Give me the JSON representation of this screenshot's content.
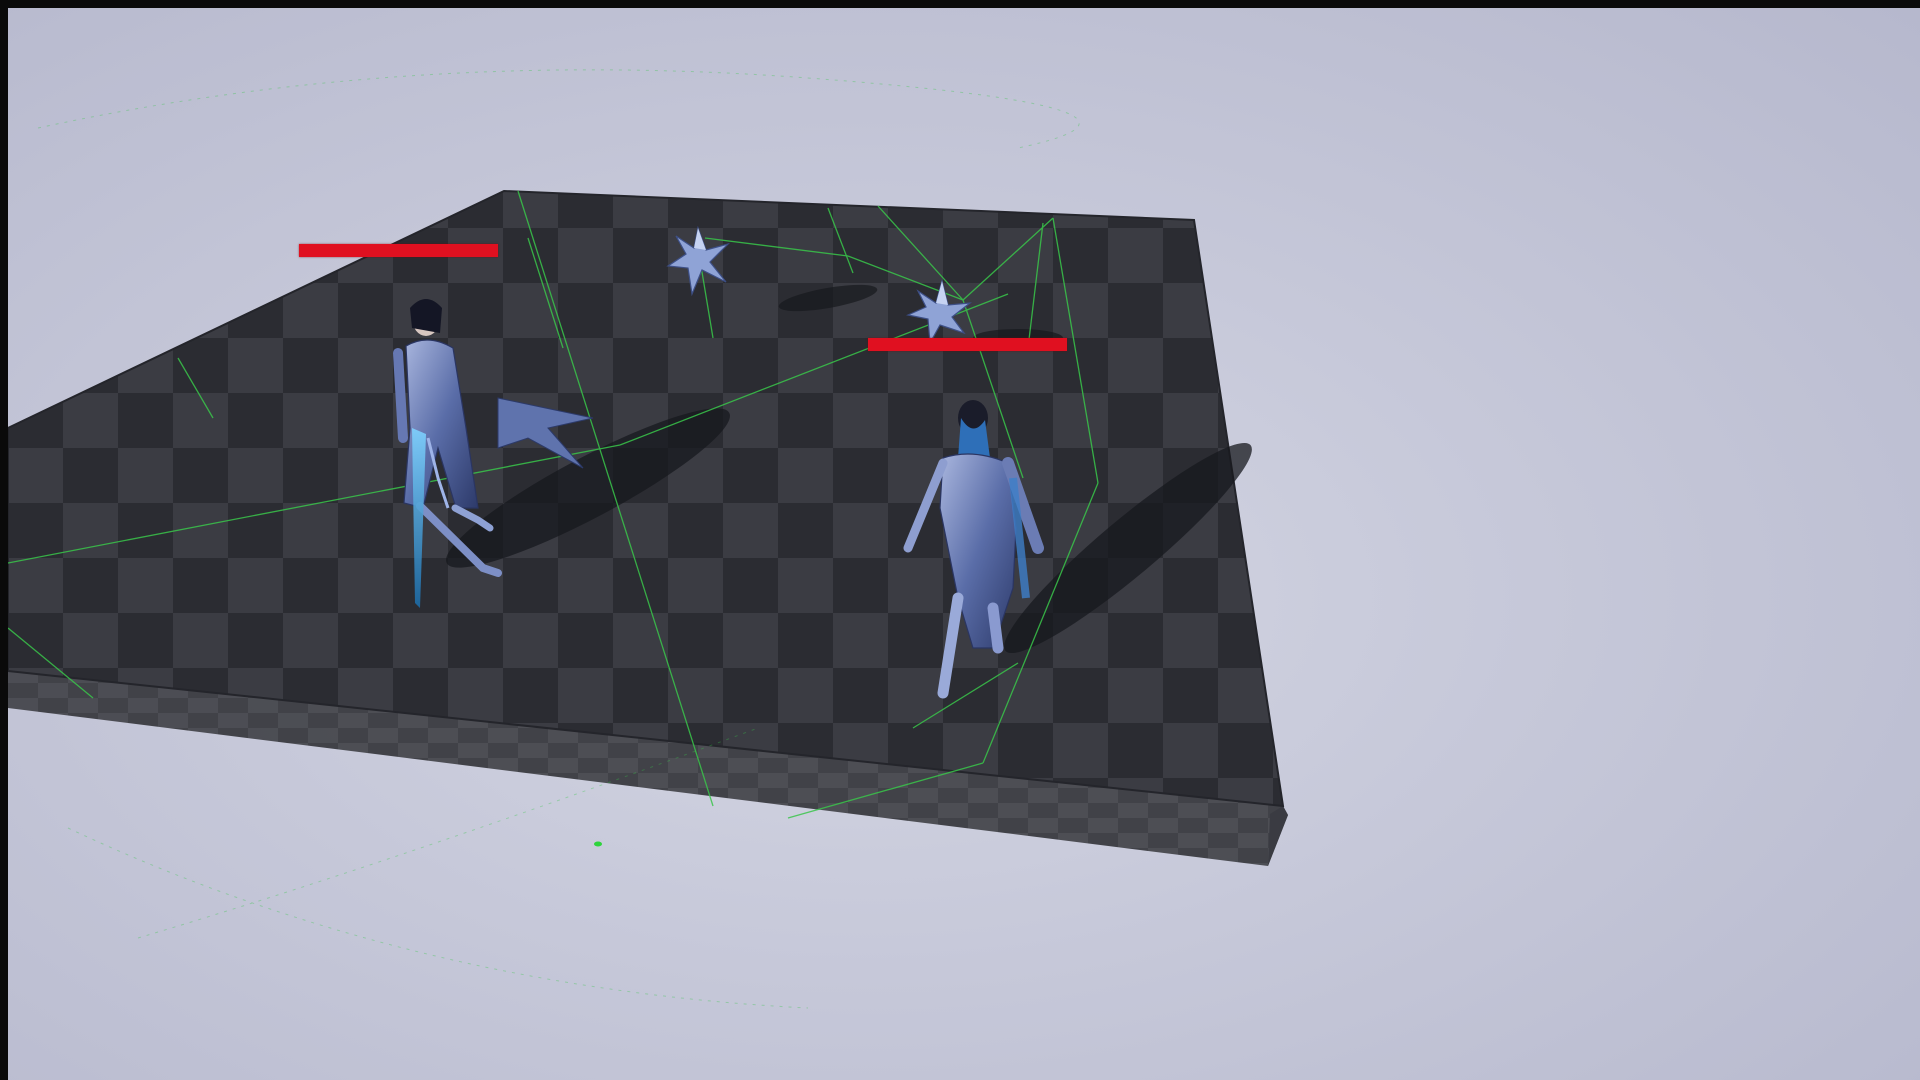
{
  "scene": {
    "floor_color": "#2b2c32",
    "floor_alt_color": "#3a3b42",
    "sky_color": "#c6c8d9",
    "debug_line_color": "#39c64a",
    "health_bar_color": "#e01020"
  },
  "entities": {
    "player": {
      "name": "player-character",
      "health": 1.0
    },
    "enemy": {
      "name": "enemy-character",
      "health": 1.0
    },
    "projectiles": [
      "ice-shard-projectile",
      "ice-shard-projectile"
    ]
  }
}
